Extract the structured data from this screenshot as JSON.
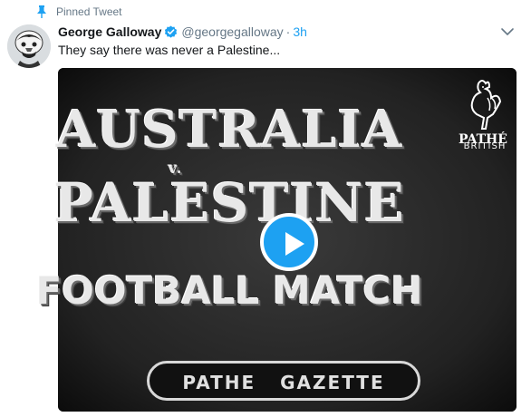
{
  "pinned": {
    "label": "Pinned Tweet",
    "icon": "pin-icon"
  },
  "author": {
    "name": "George Galloway",
    "handle": "@georgegalloway",
    "separator": "·",
    "time": "3h",
    "verified": true
  },
  "tweet": {
    "text": "They say there was never a Palestine..."
  },
  "media": {
    "type": "video",
    "title_lines": [
      "AUSTRALIA",
      "v.",
      "PALESTINE",
      "FOOTBALL MATCH"
    ],
    "footer": "PATHE GAZETTE",
    "logo_small": "BRITISH",
    "logo_name": "PATHÉ",
    "play_icon": "play-icon"
  },
  "colors": {
    "accent": "#1da1f2",
    "muted": "#657786",
    "text": "#14171a"
  }
}
